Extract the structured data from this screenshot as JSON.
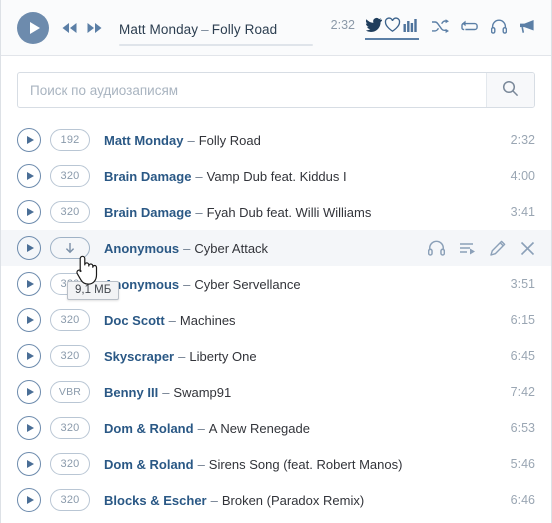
{
  "player": {
    "play_icon": "play-icon",
    "prev_icon": "rewind-icon",
    "next_icon": "fast-forward-icon",
    "artist": "Matt Monday",
    "dash": "–",
    "title": "Folly Road",
    "time": "2:32",
    "progress_percent": 0,
    "icons": {
      "twitter": "twitter-bird-icon",
      "heart": "heart-icon",
      "equalizer": "equalizer-icon",
      "shuffle": "shuffle-icon",
      "repeat": "repeat-icon",
      "headphones": "headphones-icon",
      "broadcast": "broadcast-icon"
    },
    "accent_color": "#5b7fa6"
  },
  "search": {
    "value": "",
    "placeholder": "Поиск по аудиозаписям",
    "button_icon": "search-icon"
  },
  "tooltip": {
    "text": "9,1 МБ"
  },
  "row_actions": {
    "listen_icon": "headphones-icon",
    "add_to_playlist_icon": "playlist-add-icon",
    "edit_icon": "pencil-icon",
    "remove_icon": "close-icon"
  },
  "tracks": [
    {
      "badge": "192",
      "artist": "Matt Monday",
      "dash": "–",
      "title": "Folly Road",
      "duration": "2:32",
      "hovered": false
    },
    {
      "badge": "320",
      "artist": "Brain Damage",
      "dash": "–",
      "title": "Vamp Dub feat. Kiddus I",
      "duration": "4:00",
      "hovered": false
    },
    {
      "badge": "320",
      "artist": "Brain Damage",
      "dash": "–",
      "title": "Fyah Dub feat. Willi Williams",
      "duration": "3:41",
      "hovered": false
    },
    {
      "badge": "download-icon",
      "artist": "Anonymous",
      "dash": "–",
      "title": "Cyber Attack",
      "duration": "",
      "hovered": true
    },
    {
      "badge": "320",
      "artist": "Anonymous",
      "dash": "–",
      "title": "Cyber Servellance",
      "duration": "3:51",
      "hovered": false
    },
    {
      "badge": "320",
      "artist": "Doc Scott",
      "dash": "–",
      "title": "Machines",
      "duration": "6:15",
      "hovered": false
    },
    {
      "badge": "320",
      "artist": "Skyscraper",
      "dash": "–",
      "title": "Liberty One",
      "duration": "6:45",
      "hovered": false
    },
    {
      "badge": "VBR",
      "artist": "Benny III",
      "dash": "–",
      "title": "Swamp91",
      "duration": "7:42",
      "hovered": false
    },
    {
      "badge": "320",
      "artist": "Dom & Roland",
      "dash": "–",
      "title": "A New Renegade",
      "duration": "6:53",
      "hovered": false
    },
    {
      "badge": "320",
      "artist": "Dom & Roland",
      "dash": "–",
      "title": "Sirens Song (feat. Robert Manos)",
      "duration": "5:46",
      "hovered": false
    },
    {
      "badge": "320",
      "artist": "Blocks & Escher",
      "dash": "–",
      "title": "Broken (Paradox Remix)",
      "duration": "6:46",
      "hovered": false
    }
  ]
}
